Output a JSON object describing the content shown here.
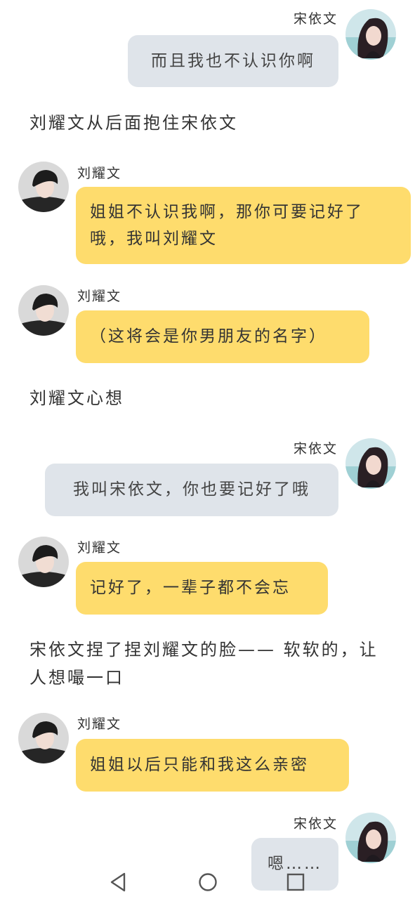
{
  "characters": {
    "female": {
      "name": "宋依文",
      "avatar_icon": "girl-portrait-avatar"
    },
    "male": {
      "name": "刘耀文",
      "avatar_icon": "boy-portrait-avatar"
    }
  },
  "messages": [
    {
      "type": "right",
      "speaker": "宋依文",
      "text": "而且我也不认识你啊"
    },
    {
      "type": "narration",
      "text": "刘耀文从后面抱住宋依文"
    },
    {
      "type": "left",
      "speaker": "刘耀文",
      "text": "姐姐不认识我啊，那你可要记好了哦，我叫刘耀文"
    },
    {
      "type": "left",
      "speaker": "刘耀文",
      "text": "（这将会是你男朋友的名字）"
    },
    {
      "type": "narration",
      "text": "刘耀文心想"
    },
    {
      "type": "right",
      "speaker": "宋依文",
      "text": "我叫宋依文，你也要记好了哦"
    },
    {
      "type": "left",
      "speaker": "刘耀文",
      "text": "记好了，一辈子都不会忘"
    },
    {
      "type": "narration",
      "text": "宋依文捏了捏刘耀文的脸—— 软软的，让人想嘬一口"
    },
    {
      "type": "left",
      "speaker": "刘耀文",
      "text": "姐姐以后只能和我这么亲密"
    },
    {
      "type": "right",
      "speaker": "宋依文",
      "text": "嗯……"
    }
  ],
  "navbar": {
    "back_icon": "back-triangle-icon",
    "home_icon": "home-circle-icon",
    "recents_icon": "recents-square-icon"
  },
  "colors": {
    "right_bubble": "#dfe4ea",
    "left_bubble": "#fedc6d",
    "background": "#ffffff"
  }
}
